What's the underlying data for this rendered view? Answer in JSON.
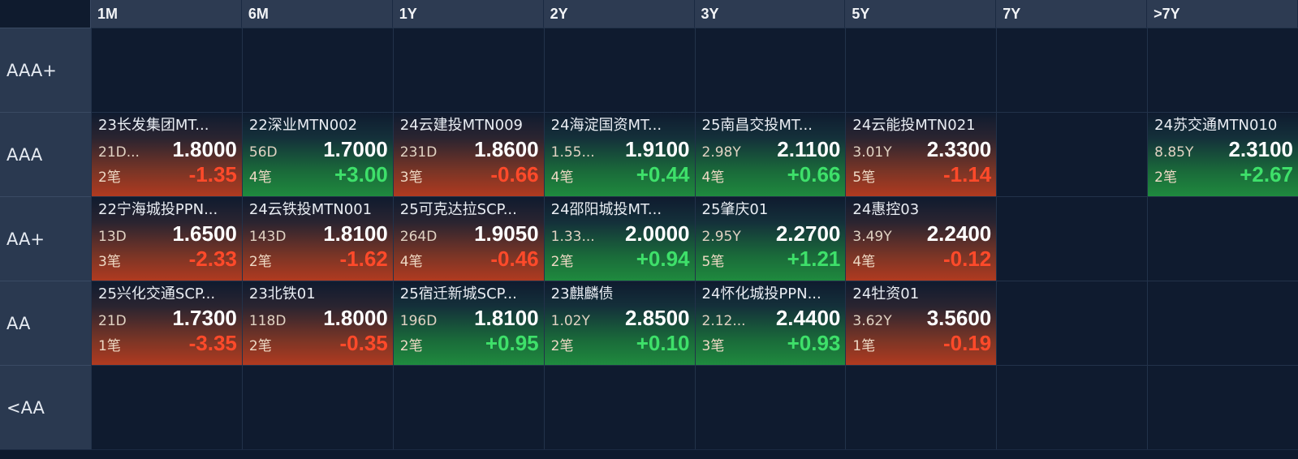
{
  "columns": [
    "1M",
    "6M",
    "1Y",
    "2Y",
    "3Y",
    "5Y",
    "7Y",
    ">7Y"
  ],
  "rows": [
    {
      "label": "AAA+",
      "cells": [
        null,
        null,
        null,
        null,
        null,
        null,
        null,
        null
      ]
    },
    {
      "label": "AAA",
      "cells": [
        {
          "name": "23长发集团MT...",
          "term": "21D...",
          "yield": "1.8000",
          "count": "2笔",
          "change": "-1.35",
          "dir": "down"
        },
        {
          "name": "22深业MTN002",
          "term": "56D",
          "yield": "1.7000",
          "count": "4笔",
          "change": "+3.00",
          "dir": "up"
        },
        {
          "name": "24云建投MTN009",
          "term": "231D",
          "yield": "1.8600",
          "count": "3笔",
          "change": "-0.66",
          "dir": "down"
        },
        {
          "name": "24海淀国资MT...",
          "term": "1.55...",
          "yield": "1.9100",
          "count": "4笔",
          "change": "+0.44",
          "dir": "up"
        },
        {
          "name": "25南昌交投MT...",
          "term": "2.98Y",
          "yield": "2.1100",
          "count": "4笔",
          "change": "+0.66",
          "dir": "up"
        },
        {
          "name": "24云能投MTN021",
          "term": "3.01Y",
          "yield": "2.3300",
          "count": "5笔",
          "change": "-1.14",
          "dir": "down"
        },
        null,
        {
          "name": "24苏交通MTN010",
          "term": "8.85Y",
          "yield": "2.3100",
          "count": "2笔",
          "change": "+2.67",
          "dir": "up"
        }
      ]
    },
    {
      "label": "AA+",
      "cells": [
        {
          "name": "22宁海城投PPN...",
          "term": "13D",
          "yield": "1.6500",
          "count": "3笔",
          "change": "-2.33",
          "dir": "down"
        },
        {
          "name": "24云铁投MTN001",
          "term": "143D",
          "yield": "1.8100",
          "count": "2笔",
          "change": "-1.62",
          "dir": "down"
        },
        {
          "name": "25可克达拉SCP...",
          "term": "264D",
          "yield": "1.9050",
          "count": "4笔",
          "change": "-0.46",
          "dir": "down"
        },
        {
          "name": "24邵阳城投MT...",
          "term": "1.33...",
          "yield": "2.0000",
          "count": "2笔",
          "change": "+0.94",
          "dir": "up"
        },
        {
          "name": "25肇庆01",
          "term": "2.95Y",
          "yield": "2.2700",
          "count": "5笔",
          "change": "+1.21",
          "dir": "up"
        },
        {
          "name": "24惠控03",
          "term": "3.49Y",
          "yield": "2.2400",
          "count": "4笔",
          "change": "-0.12",
          "dir": "down"
        },
        null,
        null
      ]
    },
    {
      "label": "AA",
      "cells": [
        {
          "name": "25兴化交通SCP...",
          "term": "21D",
          "yield": "1.7300",
          "count": "1笔",
          "change": "-3.35",
          "dir": "down"
        },
        {
          "name": "23北铁01",
          "term": "118D",
          "yield": "1.8000",
          "count": "2笔",
          "change": "-0.35",
          "dir": "down"
        },
        {
          "name": "25宿迁新城SCP...",
          "term": "196D",
          "yield": "1.8100",
          "count": "2笔",
          "change": "+0.95",
          "dir": "up"
        },
        {
          "name": "23麒麟债",
          "term": "1.02Y",
          "yield": "2.8500",
          "count": "2笔",
          "change": "+0.10",
          "dir": "up"
        },
        {
          "name": "24怀化城投PPN...",
          "term": "2.12...",
          "yield": "2.4400",
          "count": "3笔",
          "change": "+0.93",
          "dir": "up"
        },
        {
          "name": "24牡资01",
          "term": "3.62Y",
          "yield": "3.5600",
          "count": "1笔",
          "change": "-0.19",
          "dir": "down"
        },
        null,
        null
      ]
    },
    {
      "label": "<AA",
      "cells": [
        null,
        null,
        null,
        null,
        null,
        null,
        null,
        null
      ]
    }
  ],
  "colors": {
    "up": "#3ee06a",
    "down": "#ff4a2a",
    "header_bg": "#2d3b52",
    "cell_bg": "#0f1b2f"
  }
}
